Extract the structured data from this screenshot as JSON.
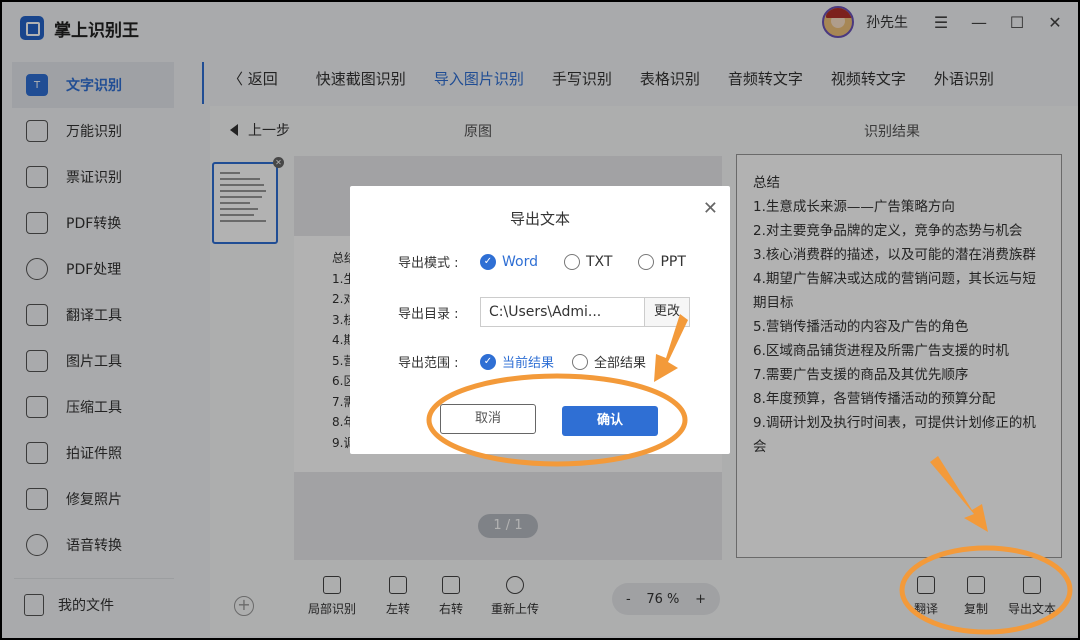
{
  "app": {
    "name": "掌上识别王"
  },
  "sidebar": {
    "items": [
      {
        "label": "文字识别",
        "icon": "text-recognition-icon",
        "glyph": "T",
        "active": true
      },
      {
        "label": "万能识别",
        "icon": "universal-scan-icon",
        "glyph": ""
      },
      {
        "label": "票证识别",
        "icon": "ticket-icon",
        "glyph": ""
      },
      {
        "label": "PDF转换",
        "icon": "pdf-convert-icon",
        "glyph": ""
      },
      {
        "label": "PDF处理",
        "icon": "pdf-process-icon",
        "glyph": ""
      },
      {
        "label": "翻译工具",
        "icon": "translate-icon",
        "glyph": ""
      },
      {
        "label": "图片工具",
        "icon": "image-tool-icon",
        "glyph": ""
      },
      {
        "label": "压缩工具",
        "icon": "compress-icon",
        "glyph": ""
      },
      {
        "label": "拍证件照",
        "icon": "id-photo-icon",
        "glyph": ""
      },
      {
        "label": "修复照片",
        "icon": "photo-repair-icon",
        "glyph": ""
      },
      {
        "label": "语音转换",
        "icon": "voice-convert-icon",
        "glyph": ""
      }
    ],
    "my_files": "我的文件"
  },
  "topbar": {
    "username": "孙先生",
    "menu": "☰",
    "minimize": "—",
    "maximize": "☐",
    "close": "✕"
  },
  "tabs": {
    "back": "返回",
    "items": [
      "快速截图识别",
      "导入图片识别",
      "手写识别",
      "表格识别",
      "音频转文字",
      "视频转文字",
      "外语识别"
    ],
    "active_index": 1
  },
  "panel": {
    "prev_step": "上一步",
    "original_heading": "原图",
    "result_heading": "识别结果",
    "doc_lines": [
      "总结",
      "1.生",
      "2.对",
      "3.核",
      "4.期",
      "5.营",
      "6.区",
      "7.需",
      "8.年",
      "9.调"
    ],
    "page_indicator": "1 / 1",
    "result_text": [
      "总结",
      "1.生意成长来源——广告策略方向",
      "2.对主要竞争品牌的定义，竞争的态势与机会",
      "3.核心消费群的描述，以及可能的潜在消费族群",
      "4.期望广告解决或达成的营销问题，其长远与短期目标",
      "5.营销传播活动的内容及广告的角色",
      "6.区域商品铺货进程及所需广告支援的时机",
      "7.需要广告支援的商品及其优先顺序",
      "8.年度预算，各营销传播活动的预算分配",
      "9.调研计划及执行时间表，可提供计划修正的机会"
    ]
  },
  "toolbar": {
    "local_recognize": "局部识别",
    "rotate_left": "左转",
    "rotate_right": "右转",
    "reupload": "重新上传",
    "zoom_minus": "-",
    "zoom_value": "76 %",
    "zoom_plus": "+",
    "translate": "翻译",
    "copy": "复制",
    "export_text": "导出文本"
  },
  "dialog": {
    "title": "导出文本",
    "mode_label": "导出模式 :",
    "mode_options": [
      "Word",
      "TXT",
      "PPT"
    ],
    "mode_selected": "Word",
    "dir_label": "导出目录 :",
    "dir_value": "C:\\Users\\Admi...",
    "dir_change": "更改",
    "range_label": "导出范围 :",
    "range_options": [
      "当前结果",
      "全部结果"
    ],
    "range_selected": "当前结果",
    "cancel": "取消",
    "confirm": "确认"
  },
  "colors": {
    "accent": "#2f6fd4",
    "annotation": "#f39a3a"
  }
}
